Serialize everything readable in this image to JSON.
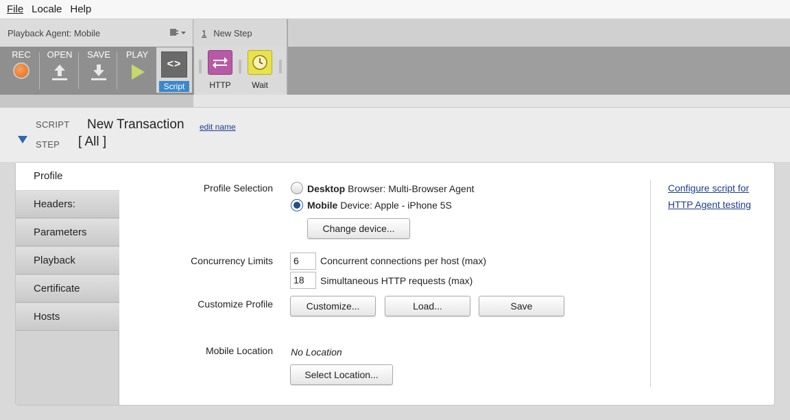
{
  "menu": {
    "file": "File",
    "locale": "Locale",
    "help": "Help"
  },
  "toolbar": {
    "agent_label": "Playback Agent: Mobile",
    "step_number": "1",
    "step_name": "New Step",
    "rec": "REC",
    "open": "OPEN",
    "save": "SAVE",
    "play": "PLAY",
    "script": "Script",
    "script_glyph": "<>",
    "http": "HTTP",
    "wait": "Wait"
  },
  "header": {
    "script_label": "SCRIPT",
    "step_label": "STEP",
    "transaction_name": "New Transaction",
    "step_value": "[ All ]",
    "edit_name": "edit name"
  },
  "tabs": [
    {
      "label": "Profile",
      "active": true
    },
    {
      "label": "Headers:",
      "active": false
    },
    {
      "label": "Parameters",
      "active": false
    },
    {
      "label": "Playback",
      "active": false
    },
    {
      "label": "Certificate",
      "active": false
    },
    {
      "label": "Hosts",
      "active": false
    }
  ],
  "profile": {
    "profile_selection_label": "Profile Selection",
    "desktop_bold": "Desktop",
    "desktop_rest": " Browser: Multi-Browser Agent",
    "mobile_bold": "Mobile",
    "mobile_rest": " Device: Apple - iPhone 5S",
    "selected": "mobile",
    "change_device": "Change device...",
    "concurrency_label": "Concurrency Limits",
    "connections_value": "6",
    "connections_text": "Concurrent connections per host (max)",
    "requests_value": "18",
    "requests_text": "Simultaneous HTTP requests (max)",
    "customize_label": "Customize Profile",
    "customize_btn": "Customize...",
    "load_btn": "Load...",
    "save_btn": "Save",
    "location_label": "Mobile Location",
    "location_value": "No Location",
    "select_location_btn": "Select Location...",
    "configure_link_line1": "Configure script for",
    "configure_link_line2": "HTTP Agent testing"
  },
  "colors": {
    "accent": "#3c87c9",
    "http_tool": "#b75aa6",
    "wait_tool": "#e9e24a",
    "link": "#1a3c8e",
    "radio_selected": "#1f4f8c"
  }
}
